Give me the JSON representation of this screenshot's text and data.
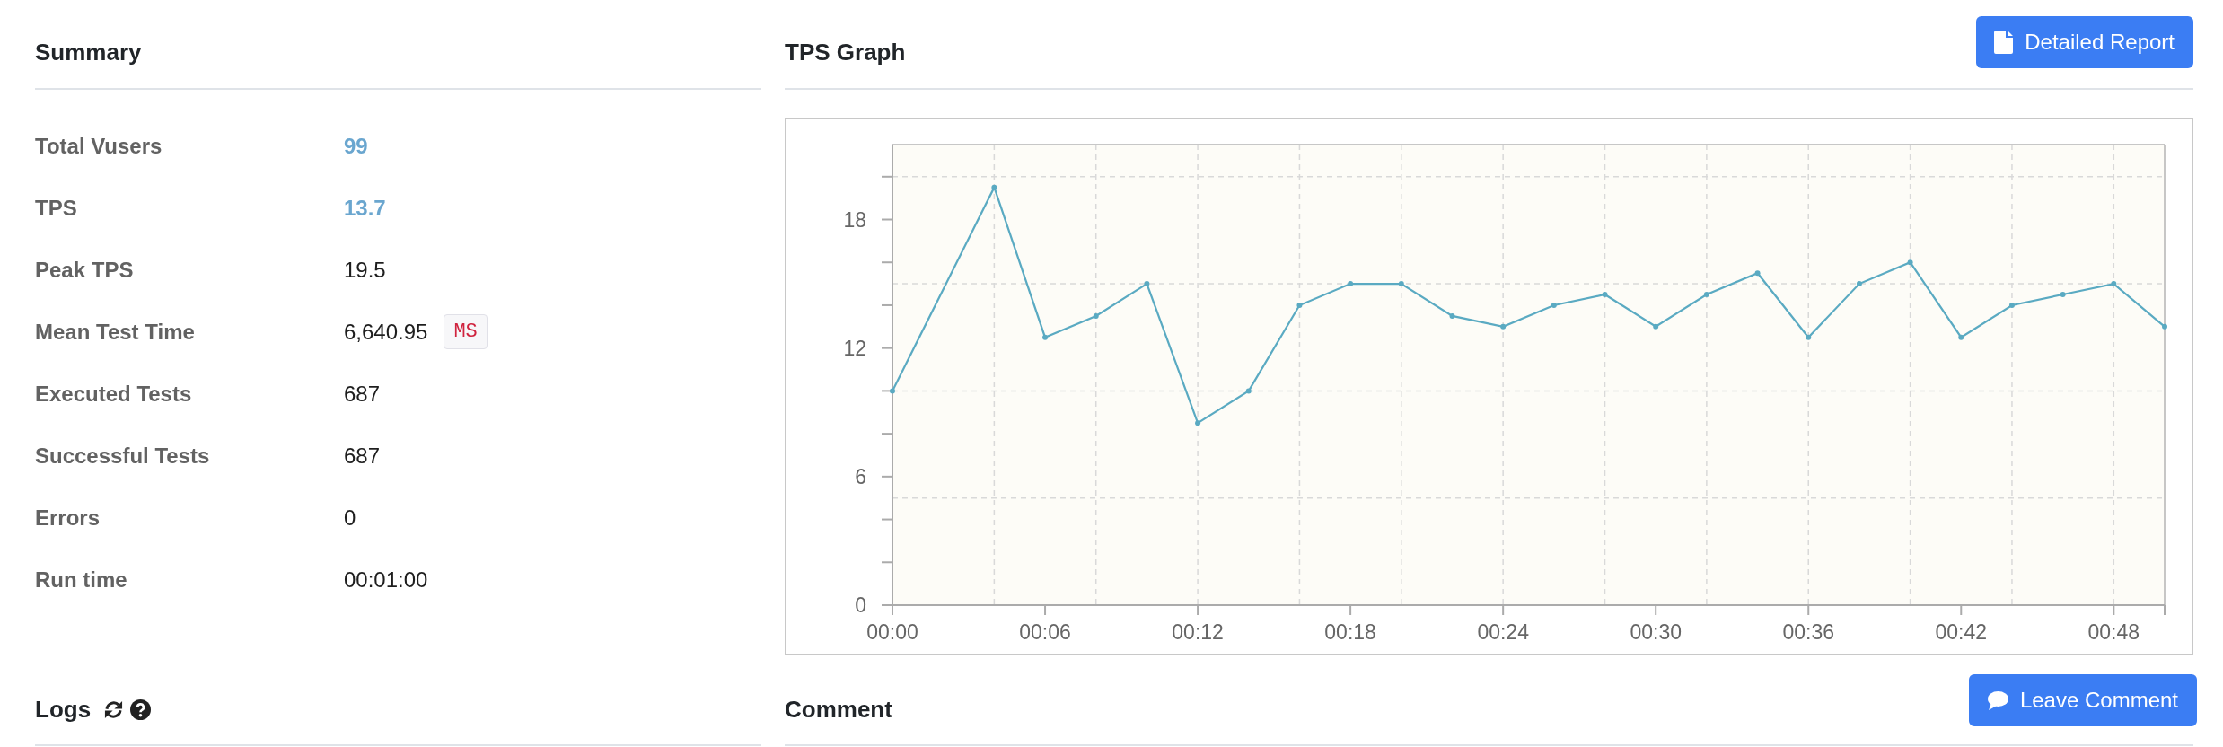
{
  "summary": {
    "title": "Summary",
    "rows": [
      {
        "label": "Total Vusers",
        "value": "99",
        "kind": "highlight"
      },
      {
        "label": "TPS",
        "value": "13.7",
        "kind": "highlight"
      },
      {
        "label": "Peak TPS",
        "value": "19.5",
        "kind": "plain"
      },
      {
        "label": "Mean Test Time",
        "value": "6,640.95",
        "unit": "MS",
        "kind": "plain"
      },
      {
        "label": "Executed Tests",
        "value": "687",
        "kind": "plain"
      },
      {
        "label": "Successful Tests",
        "value": "687",
        "kind": "plain"
      },
      {
        "label": "Errors",
        "value": "0",
        "kind": "plain"
      },
      {
        "label": "Run time",
        "value": "00:01:00",
        "kind": "plain"
      }
    ]
  },
  "tps_graph": {
    "title": "TPS Graph",
    "button": "Detailed Report",
    "chart_data": {
      "type": "line",
      "grid": true,
      "x": [
        0,
        4,
        6,
        8,
        10,
        12,
        14,
        16,
        18,
        20,
        22,
        24,
        26,
        28,
        30,
        32,
        34,
        36,
        38,
        40,
        42,
        44,
        46,
        48,
        50
      ],
      "series": [
        {
          "color": "#5aaac2",
          "marker": "circle",
          "values": [
            10,
            19.5,
            12.5,
            13.5,
            15,
            8.5,
            10,
            14,
            15,
            15,
            13.5,
            13,
            14,
            14.5,
            13,
            14.5,
            15.5,
            12.5,
            15,
            16,
            12.5,
            14,
            14.5,
            15,
            13
          ]
        }
      ],
      "xlim": [
        0,
        50
      ],
      "ylim": [
        0,
        21.5
      ],
      "xticks": [
        {
          "value": 0,
          "label": "00:00"
        },
        {
          "value": 6,
          "label": "00:06"
        },
        {
          "value": 12,
          "label": "00:12"
        },
        {
          "value": 18,
          "label": "00:18"
        },
        {
          "value": 24,
          "label": "00:24"
        },
        {
          "value": 30,
          "label": "00:30"
        },
        {
          "value": 36,
          "label": "00:36"
        },
        {
          "value": 42,
          "label": "00:42"
        },
        {
          "value": 48,
          "label": "00:48"
        }
      ],
      "yticks": [
        0,
        6,
        12,
        18
      ]
    }
  },
  "logs": {
    "title": "Logs"
  },
  "comment": {
    "title": "Comment",
    "button": "Leave Comment"
  }
}
